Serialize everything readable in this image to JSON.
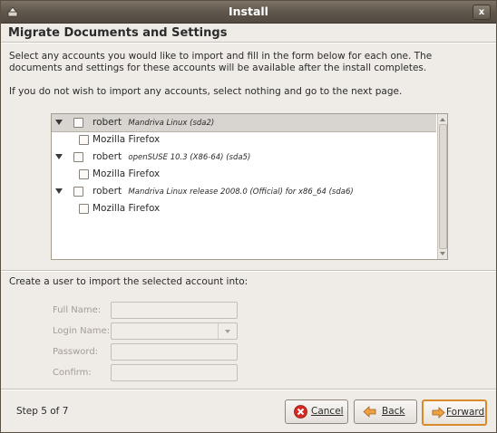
{
  "window": {
    "title": "Install",
    "close_label": "x"
  },
  "page": {
    "heading": "Migrate Documents and Settings",
    "intro_line1": "Select any accounts you would like to import and fill in the form below for each one.  The",
    "intro_line2": "documents and settings for these accounts will be available after the install completes.",
    "intro_line3": "If you do not wish to import any accounts, select nothing and go to the next page."
  },
  "accounts": [
    {
      "user": "robert",
      "source": "Mandriva Linux (sda2)",
      "item": "Mozilla Firefox"
    },
    {
      "user": "robert",
      "source": "openSUSE 10.3 (X86-64) (sda5)",
      "item": "Mozilla Firefox"
    },
    {
      "user": "robert",
      "source": "Mandriva Linux release 2008.0 (Official) for x86_64 (sda6)",
      "item": "Mozilla Firefox"
    }
  ],
  "form": {
    "prompt": "Create a user to import the selected account into:",
    "full_name_label": "Full Name:",
    "login_name_label": "Login Name:",
    "password_label": "Password:",
    "confirm_label": "Confirm:"
  },
  "footer": {
    "step": "Step 5 of 7",
    "cancel_label": "Cancel",
    "back_label": "Back",
    "forward_label": "Forward"
  },
  "colors": {
    "accent": "#d98a2a",
    "titlebar": "#5f574c",
    "background": "#efebe7",
    "cancel_icon": "#d42a22",
    "arrow_icon": "#f0a040"
  }
}
